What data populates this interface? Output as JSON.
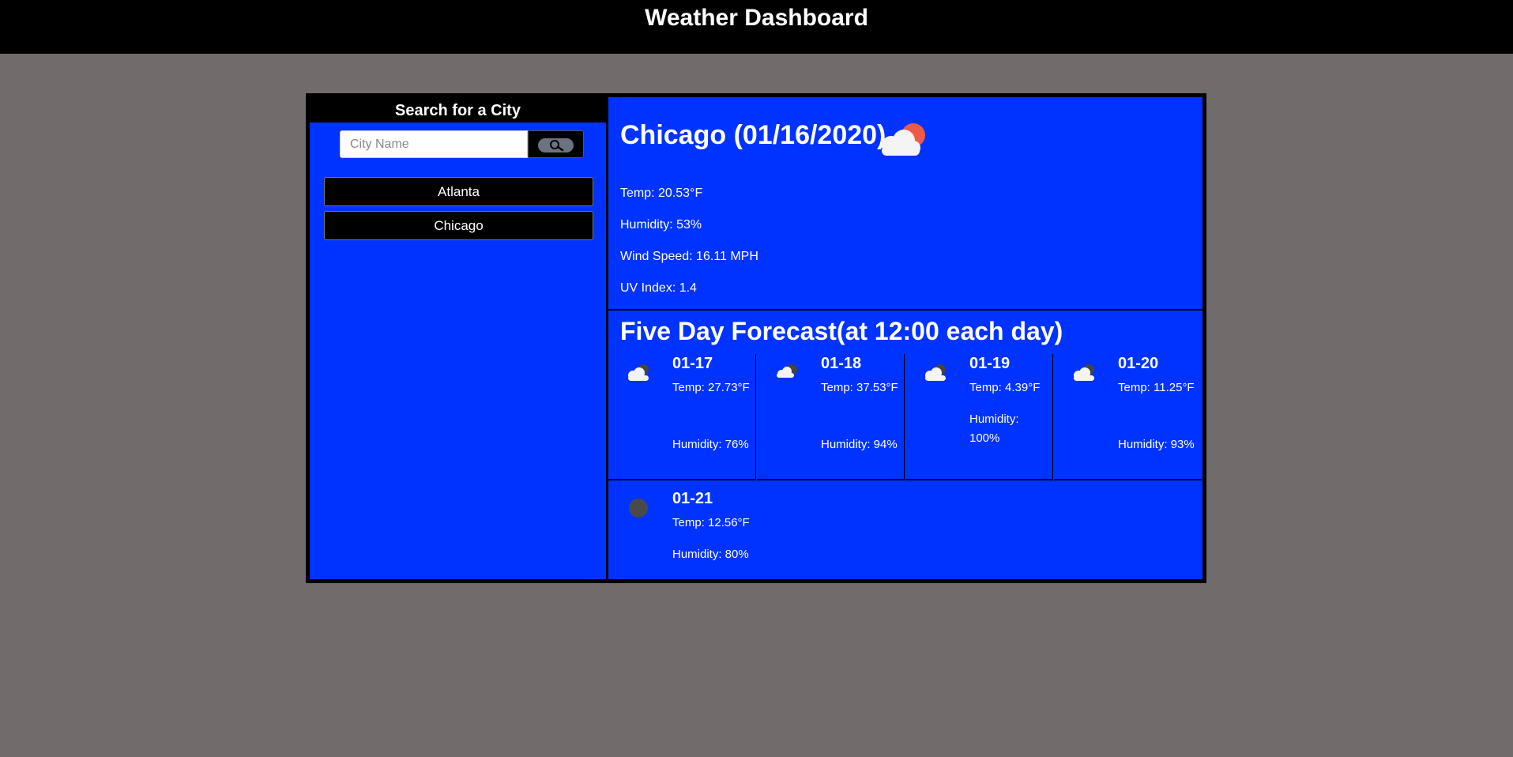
{
  "header": {
    "title": "Weather Dashboard"
  },
  "sidebar": {
    "title": "Search for a City",
    "search": {
      "placeholder": "City Name",
      "value": ""
    },
    "search_button_icon": "search-icon",
    "history": [
      {
        "label": "Atlanta"
      },
      {
        "label": "Chicago"
      }
    ]
  },
  "current": {
    "title": "Chicago (01/16/2020)",
    "icon": "partly-cloudy-day-icon",
    "temp": "Temp: 20.53°F",
    "humidity": "Humidity: 53%",
    "wind": "Wind Speed: 16.11 MPH",
    "uv": "UV Index: 1.4"
  },
  "forecast": {
    "title": "Five Day Forecast(at 12:00 each day)",
    "days": [
      {
        "date": "01-17",
        "icon": "cloudy-night-icon",
        "temp": "Temp: 27.73°F",
        "humidity": "Humidity: 76%"
      },
      {
        "date": "01-18",
        "icon": "cloudy-night-icon",
        "temp": "Temp: 37.53°F",
        "humidity": "Humidity: 94%"
      },
      {
        "date": "01-19",
        "icon": "cloudy-night-icon",
        "temp": "Temp: 4.39°F",
        "humidity": "Humidity: 100%"
      },
      {
        "date": "01-20",
        "icon": "cloudy-night-icon",
        "temp": "Temp: 11.25°F",
        "humidity": "Humidity: 93%"
      },
      {
        "date": "01-21",
        "icon": "clear-night-icon",
        "temp": "Temp: 12.56°F",
        "humidity": "Humidity: 80%"
      }
    ]
  },
  "colors": {
    "page_background": "#716b6b",
    "panel_blue": "#0033ff",
    "header_black": "#000000",
    "sun_red": "#ee5a47"
  }
}
